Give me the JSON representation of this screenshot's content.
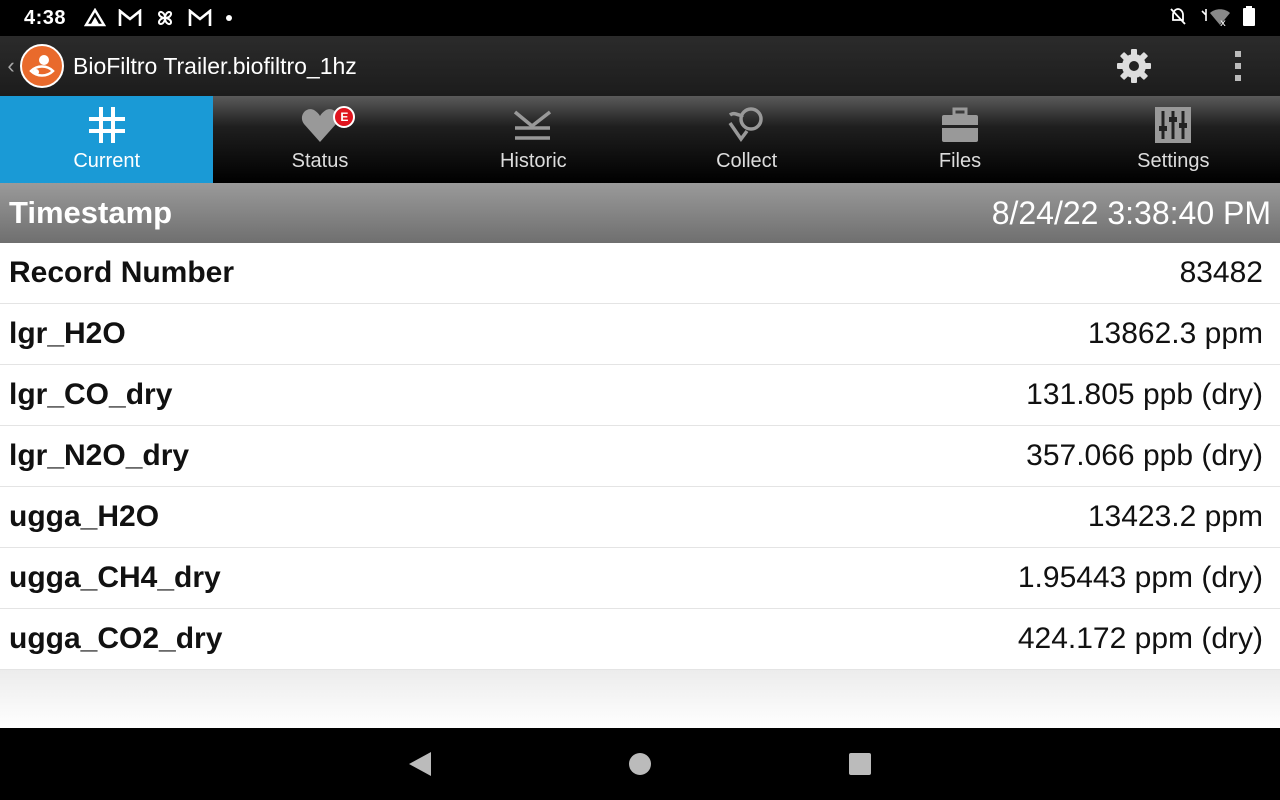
{
  "status_bar": {
    "time": "4:38",
    "notifications": [
      "drive-icon",
      "gmail-icon",
      "pinwheel-icon",
      "gmail-icon",
      "dot-icon"
    ],
    "right_icons": [
      "silent-bell-icon",
      "wifi-off-icon",
      "battery-icon"
    ]
  },
  "app_bar": {
    "title": "BioFiltro Trailer.biofiltro_1hz",
    "back_glyph": "‹"
  },
  "tabs": [
    {
      "label": "Current",
      "icon": "grid-icon",
      "active": true
    },
    {
      "label": "Status",
      "icon": "heart-icon",
      "badge": "E"
    },
    {
      "label": "Historic",
      "icon": "historic-icon"
    },
    {
      "label": "Collect",
      "icon": "collect-icon"
    },
    {
      "label": "Files",
      "icon": "briefcase-icon"
    },
    {
      "label": "Settings",
      "icon": "sliders-icon"
    }
  ],
  "timestamp": {
    "label": "Timestamp",
    "value": "8/24/22 3:38:40 PM"
  },
  "rows": [
    {
      "label": "Record Number",
      "value": "83482"
    },
    {
      "label": "lgr_H2O",
      "value": "13862.3 ppm"
    },
    {
      "label": "lgr_CO_dry",
      "value": "131.805 ppb (dry)"
    },
    {
      "label": "lgr_N2O_dry",
      "value": "357.066 ppb (dry)"
    },
    {
      "label": "ugga_H2O",
      "value": "13423.2 ppm"
    },
    {
      "label": "ugga_CH4_dry",
      "value": "1.95443 ppm (dry)"
    },
    {
      "label": "ugga_CO2_dry",
      "value": "424.172 ppm (dry)"
    }
  ],
  "colors": {
    "active_tab": "#1a9ad6",
    "logo": "#e96a2c",
    "badge": "#e0141e"
  }
}
